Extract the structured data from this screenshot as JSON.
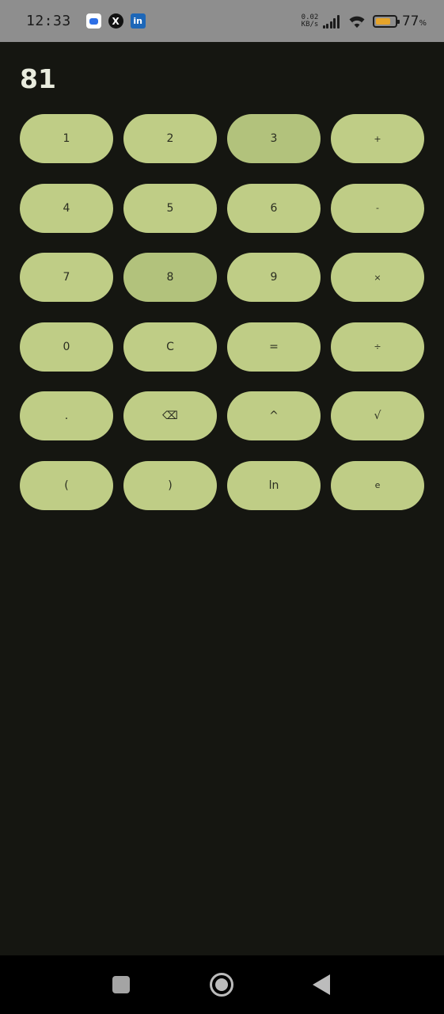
{
  "status_bar": {
    "time": "12:33",
    "net_speed_value": "0.02",
    "net_speed_unit": "KB/s",
    "battery_percent": "77",
    "battery_unit": "%",
    "battery_level": 0.77,
    "notification_icons": [
      "chat-icon",
      "x-icon",
      "linkedin-icon"
    ],
    "x_glyph": "X",
    "linkedin_glyph": "in"
  },
  "display": {
    "value": "81"
  },
  "keypad": {
    "rows": [
      [
        "1",
        "2",
        "3",
        "+"
      ],
      [
        "4",
        "5",
        "6",
        "-"
      ],
      [
        "7",
        "8",
        "9",
        "×"
      ],
      [
        "0",
        "C",
        "=",
        "÷"
      ],
      [
        ".",
        "⌫",
        "^",
        "√"
      ],
      [
        "(",
        ")",
        "ln",
        "e"
      ]
    ]
  },
  "colors": {
    "background": "#151611",
    "key": "#bfcd86",
    "key_pressed": "#b2c27c",
    "key_text": "#2b2e21",
    "display_text": "#e9ecde",
    "status_bar": "#8e8e8e",
    "battery": "#e6a42a"
  }
}
